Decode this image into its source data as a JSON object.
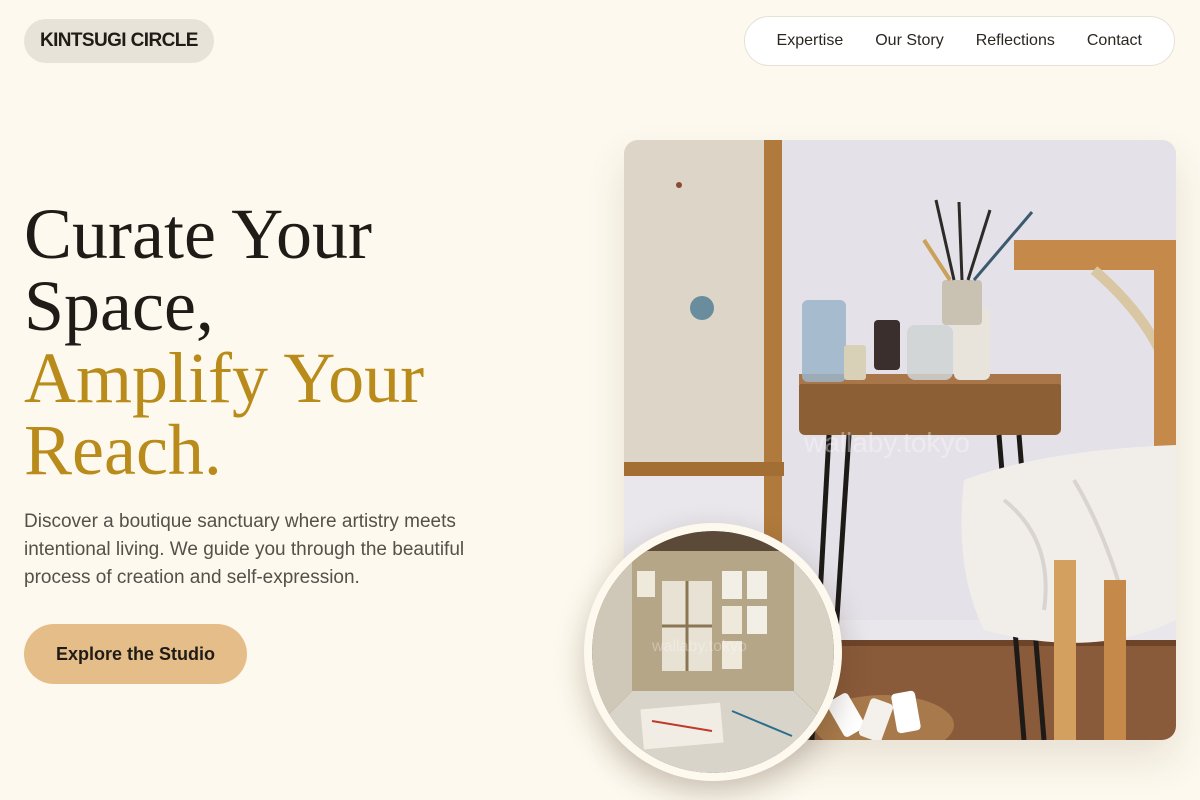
{
  "brand": {
    "name": "KINTSUGI CIRCLE"
  },
  "nav": {
    "items": [
      {
        "label": "Expertise"
      },
      {
        "label": "Our Story"
      },
      {
        "label": "Reflections"
      },
      {
        "label": "Contact"
      }
    ]
  },
  "hero": {
    "headline_line1": "Curate Your",
    "headline_line2": "Space,",
    "headline_accent1": "Amplify Your",
    "headline_accent2": "Reach.",
    "description": "Discover a boutique sanctuary where artistry meets intentional living. We guide you through the beautiful process of creation and self-expression.",
    "cta_label": "Explore the Studio"
  },
  "images": {
    "main_watermark": "wallaby.tokyo",
    "inset_watermark": "wallaby.tokyo"
  },
  "colors": {
    "background": "#fdf9ee",
    "accent": "#b98b1b",
    "cta": "#e5bd88",
    "logo_pill": "#e8e3d8"
  }
}
